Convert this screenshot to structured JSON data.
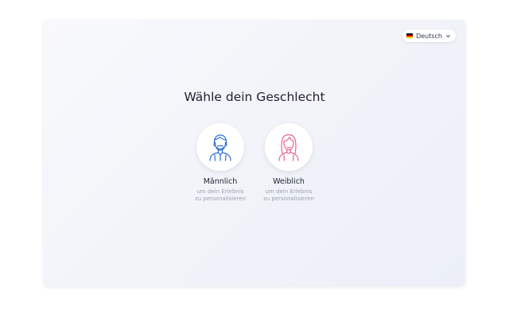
{
  "language": {
    "selected": "Deutsch",
    "flag_colors": [
      "#000000",
      "#dd0000",
      "#ffce00"
    ]
  },
  "title": "Wähle dein Geschlecht",
  "options": [
    {
      "label": "Männlich",
      "sub_line1": "um dein Erlebnis",
      "sub_line2": "zu personalisieren",
      "icon": "male-avatar-icon",
      "color": "#2f6fd6"
    },
    {
      "label": "Weiblich",
      "sub_line1": "um dein Erlebnis",
      "sub_line2": "zu personalisieren",
      "icon": "female-avatar-icon",
      "color": "#e8668f"
    }
  ]
}
